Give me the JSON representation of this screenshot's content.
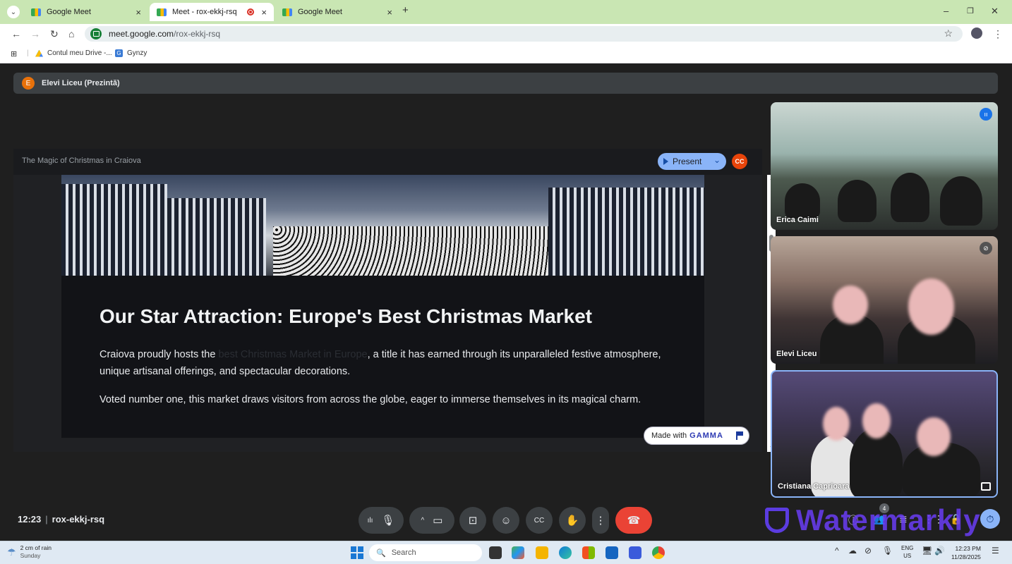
{
  "browser": {
    "tabs": [
      {
        "title": "Google Meet",
        "active": false
      },
      {
        "title": "Meet - rox-ekkj-rsq",
        "active": true,
        "recording": true
      },
      {
        "title": "Google Meet",
        "active": false
      }
    ],
    "url_host": "meet.google.com",
    "url_path": "/rox-ekkj-rsq",
    "bookmarks": [
      {
        "label": "Contul meu Drive -..."
      },
      {
        "label": "Gynzy"
      }
    ]
  },
  "meet": {
    "presenter_initial": "E",
    "presenting_label": "Elevi Liceu (Prezintă)",
    "slide_window_title": "The Magic of Christmas in Craiova",
    "present_button": "Present",
    "cc_avatar": "CC",
    "slide": {
      "heading": "Our Star Attraction: Europe's Best Christmas Market",
      "p1_before": "Craiova proudly hosts the ",
      "p1_faded": "best Christmas Market in Europe",
      "p1_after": ", a title it has earned through its unparalleled festive atmosphere, unique artisanal offerings, and spectacular decorations.",
      "p2": "Voted number one, this market draws visitors from across the globe, eager to immerse themselves in its magical charm."
    },
    "gamma_badge": {
      "made_with": "Made with",
      "brand": "GAMMA"
    },
    "participants": [
      {
        "name": "Erica Caimi",
        "status": "speaking"
      },
      {
        "name": "Elevi Liceu",
        "status": "muted"
      },
      {
        "name": "Cristiana Caprioara",
        "status": "pinned"
      }
    ],
    "time": "12:23",
    "meeting_code": "rox-ekkj-rsq",
    "people_count": "4",
    "watermark": "Watermarkly"
  },
  "taskbar": {
    "weather_line1": "2 cm of rain",
    "weather_line2": "Sunday",
    "search_placeholder": "Search",
    "lang_line1": "ENG",
    "lang_line2": "US",
    "clock_time": "12:23 PM",
    "clock_date": "11/28/2025"
  },
  "colors": {
    "accent_blue": "#8ab4f8",
    "hangup_red": "#ea4335",
    "tab_strip_green": "#c9e6b3"
  }
}
